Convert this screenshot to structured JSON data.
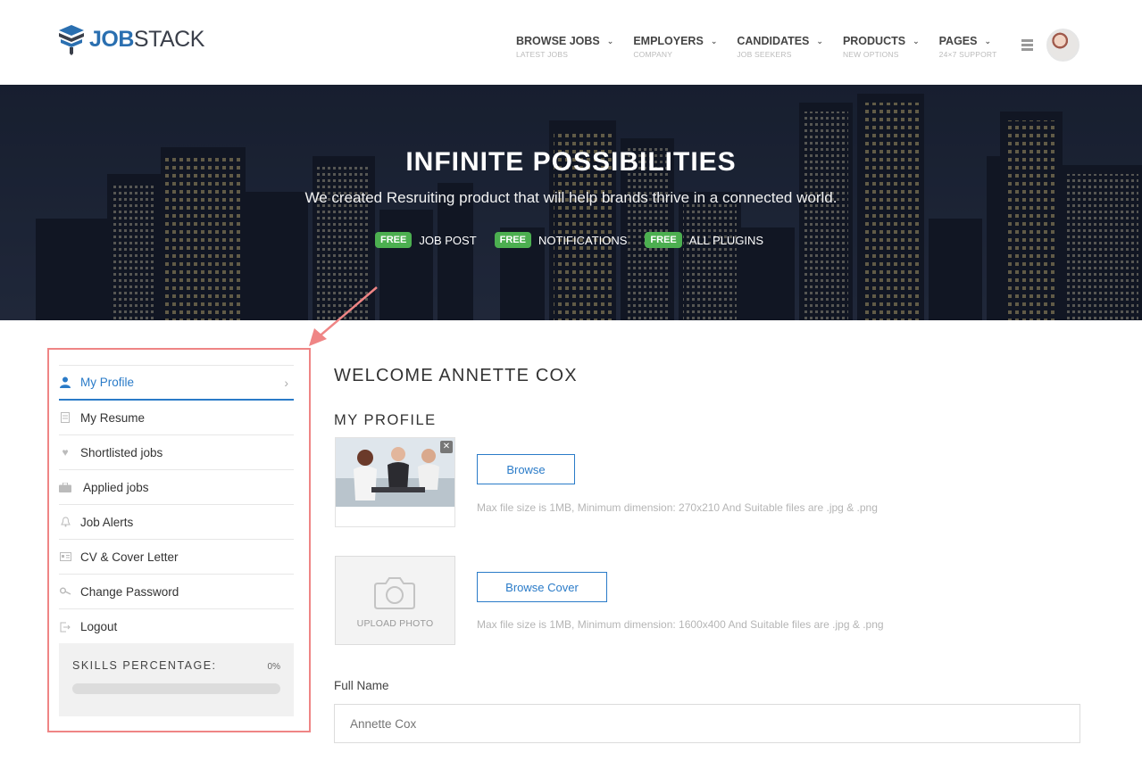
{
  "brand": {
    "name_part1": "JOB",
    "name_part2": "STACK"
  },
  "nav": [
    {
      "label": "BROWSE JOBS",
      "sub": "LATEST JOBS"
    },
    {
      "label": "EMPLOYERS",
      "sub": "COMPANY"
    },
    {
      "label": "CANDIDATES",
      "sub": "JOB SEEKERS"
    },
    {
      "label": "PRODUCTS",
      "sub": "NEW OPTIONS"
    },
    {
      "label": "PAGES",
      "sub": "24×7 SUPPORT"
    }
  ],
  "hero": {
    "title": "INFINITE POSSIBILITIES",
    "subtitle": "We created Resruiting product that will help brands thrive in a connected world.",
    "features": [
      {
        "badge": "FREE",
        "label": "JOB POST"
      },
      {
        "badge": "FREE",
        "label": "NOTIFICATIONS"
      },
      {
        "badge": "FREE",
        "label": "ALL PLUGINS"
      }
    ]
  },
  "sidebar": {
    "items": [
      {
        "label": "My Profile",
        "icon": "user-icon",
        "active": true
      },
      {
        "label": "My Resume",
        "icon": "document-icon"
      },
      {
        "label": "Shortlisted jobs",
        "icon": "heart-icon"
      },
      {
        "label": "Applied jobs",
        "icon": "briefcase-icon"
      },
      {
        "label": "Job Alerts",
        "icon": "bell-icon"
      },
      {
        "label": "CV & Cover Letter",
        "icon": "id-card-icon"
      },
      {
        "label": "Change Password",
        "icon": "key-icon"
      },
      {
        "label": "Logout",
        "icon": "logout-icon"
      }
    ],
    "skills": {
      "label": "SKILLS PERCENTAGE:",
      "value_text": "0%",
      "value": 0
    }
  },
  "main": {
    "welcome": "WELCOME ANNETTE COX",
    "section_title": "MY PROFILE",
    "browse_label": "Browse",
    "browse_hint": "Max file size is 1MB, Minimum dimension: 270x210 And Suitable files are .jpg & .png",
    "upload_photo_label": "UPLOAD PHOTO",
    "browse_cover_label": "Browse Cover",
    "cover_hint": "Max file size is 1MB, Minimum dimension: 1600x400 And Suitable files are .jpg & .png",
    "full_name_label": "Full Name",
    "full_name_value": "Annette Cox"
  },
  "colors": {
    "accent": "#2a7bc8",
    "badge": "#4caf50",
    "highlight_border": "#ef8585"
  }
}
